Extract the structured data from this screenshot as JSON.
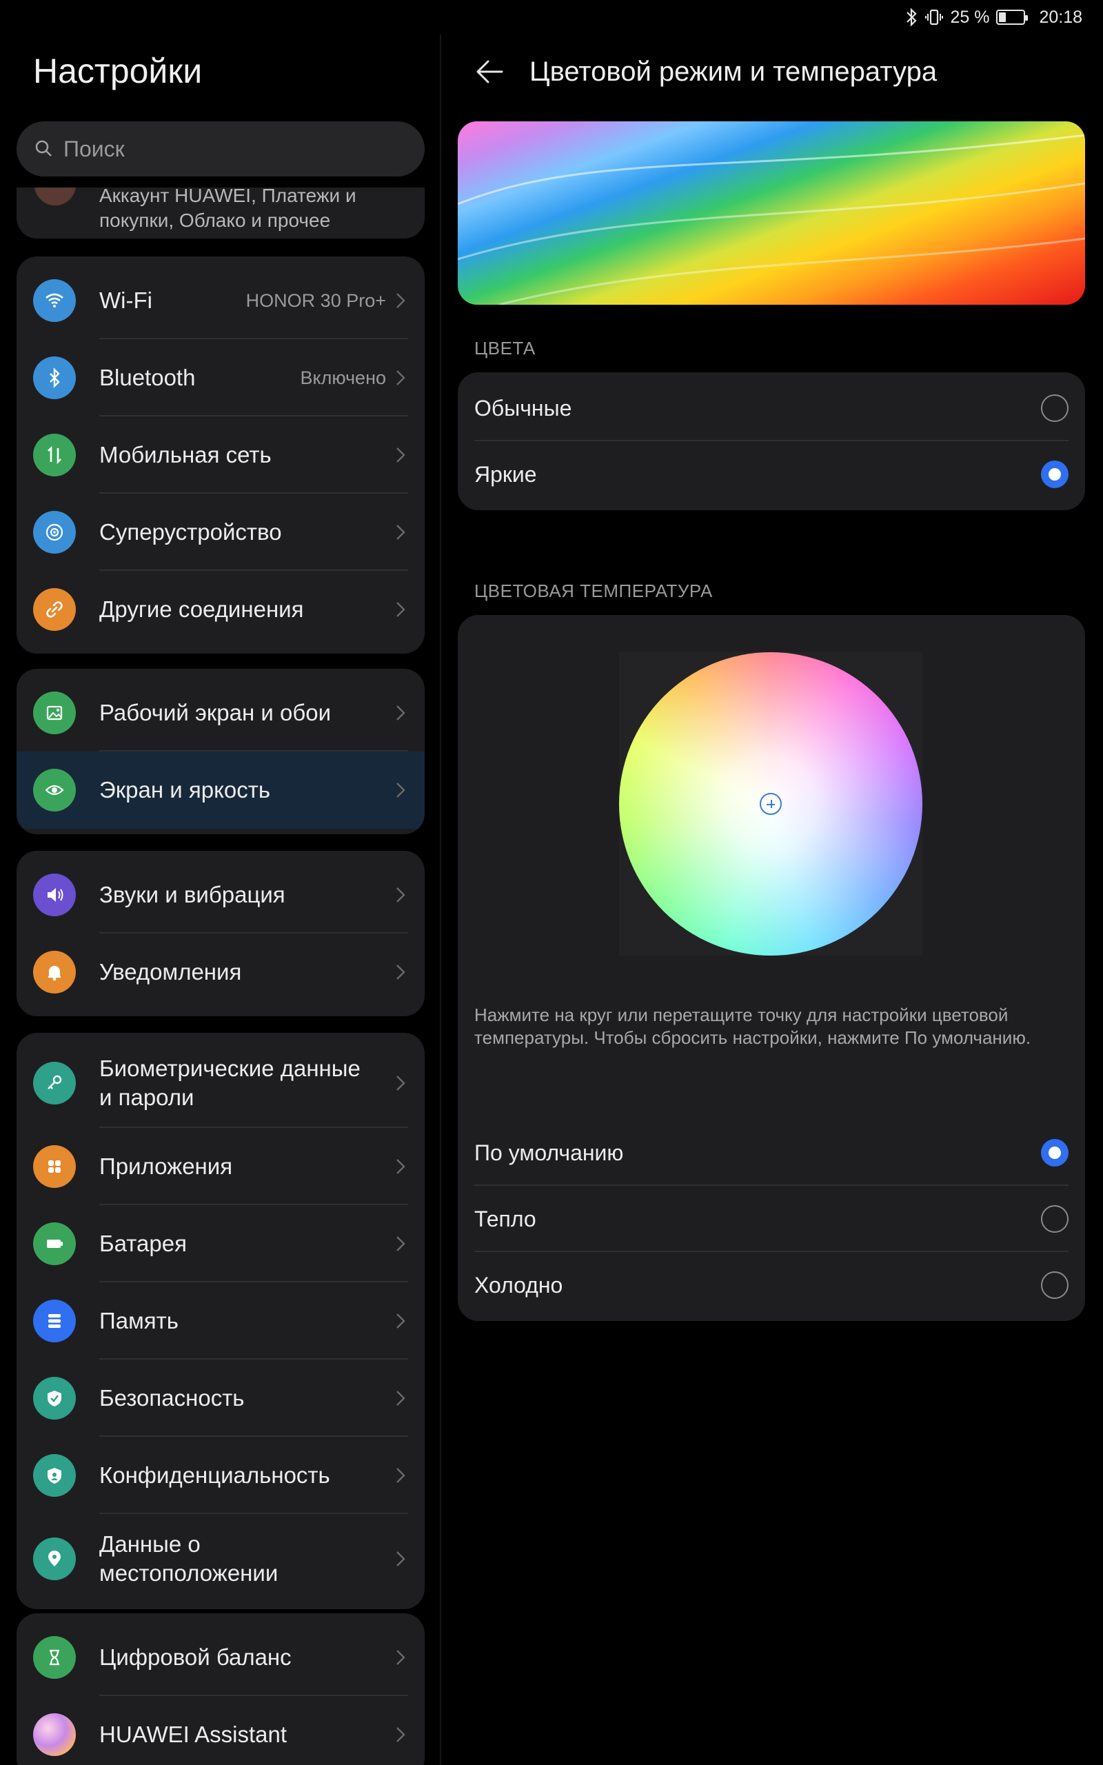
{
  "status_bar": {
    "battery_percent": "25 %",
    "time": "20:18",
    "battery_level": 0.25
  },
  "left": {
    "title": "Настройки",
    "search_placeholder": "Поиск",
    "account_text": "Аккаунт HUAWEI, Платежи и покупки, Облако и прочее",
    "groups": [
      [
        {
          "label": "Wi-Fi",
          "value": "HONOR 30 Pro+",
          "icon": "wifi-icon",
          "color": "#3b8fd6"
        },
        {
          "label": "Bluetooth",
          "value": "Включено",
          "icon": "bluetooth-icon",
          "color": "#3b8fd6"
        },
        {
          "label": "Мобильная сеть",
          "value": "",
          "icon": "mobile-network-icon",
          "color": "#3aa55a"
        },
        {
          "label": "Суперустройство",
          "value": "",
          "icon": "super-device-icon",
          "color": "#3b8fd6"
        },
        {
          "label": "Другие соединения",
          "value": "",
          "icon": "link-icon",
          "color": "#e58a2e"
        }
      ],
      [
        {
          "label": "Рабочий экран и обои",
          "value": "",
          "icon": "wallpaper-icon",
          "color": "#3aa55a"
        },
        {
          "label": "Экран и яркость",
          "value": "",
          "icon": "eye-icon",
          "color": "#3aa55a",
          "active": true
        }
      ],
      [
        {
          "label": "Звуки и вибрация",
          "value": "",
          "icon": "sound-icon",
          "color": "#6a4fd0"
        },
        {
          "label": "Уведомления",
          "value": "",
          "icon": "bell-icon",
          "color": "#e58a2e"
        }
      ],
      [
        {
          "label": "Биометрические данные и пароли",
          "value": "",
          "icon": "key-icon",
          "color": "#2fa08a",
          "tall": true
        },
        {
          "label": "Приложения",
          "value": "",
          "icon": "apps-icon",
          "color": "#e58a2e"
        },
        {
          "label": "Батарея",
          "value": "",
          "icon": "battery-icon",
          "color": "#3aa55a"
        },
        {
          "label": "Память",
          "value": "",
          "icon": "storage-icon",
          "color": "#2f6ff0"
        },
        {
          "label": "Безопасность",
          "value": "",
          "icon": "shield-icon",
          "color": "#2fa08a"
        },
        {
          "label": "Конфиденциальность",
          "value": "",
          "icon": "privacy-icon",
          "color": "#2fa08a"
        },
        {
          "label": "Данные о местоположении",
          "value": "",
          "icon": "location-icon",
          "color": "#2fa08a",
          "tall": true
        }
      ],
      [
        {
          "label": "Цифровой баланс",
          "value": "",
          "icon": "hourglass-icon",
          "color": "#3aa55a"
        },
        {
          "label": "HUAWEI Assistant",
          "value": "",
          "icon": "assistant-icon",
          "color": "#d58ad6"
        }
      ]
    ]
  },
  "right": {
    "title": "Цветовой режим и температура",
    "colors_section": "ЦВЕТА",
    "color_options": [
      {
        "label": "Обычные",
        "selected": false
      },
      {
        "label": "Яркие",
        "selected": true
      }
    ],
    "temp_section": "ЦВЕТОВАЯ ТЕМПЕРАТУРА",
    "hint": "Нажмите на круг или перетащите точку для настройки цветовой температуры. Чтобы сбросить настройки, нажмите По умолчанию.",
    "temp_options": [
      {
        "label": "По умолчанию",
        "selected": true
      },
      {
        "label": "Тепло",
        "selected": false
      },
      {
        "label": "Холодно",
        "selected": false
      }
    ]
  }
}
